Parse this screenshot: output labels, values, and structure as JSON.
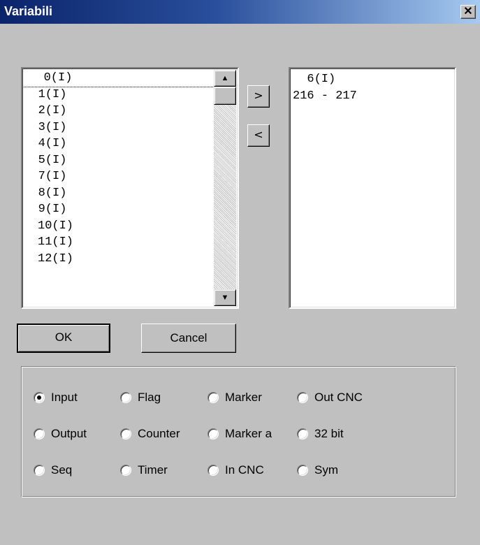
{
  "window": {
    "title": "Variabili",
    "close_glyph": "✕"
  },
  "left_list": {
    "items": [
      "0(I)",
      "1(I)",
      "2(I)",
      "3(I)",
      "4(I)",
      "5(I)",
      "7(I)",
      "8(I)",
      "9(I)",
      "10(I)",
      "11(I)",
      "12(I)"
    ],
    "focused_index": 0,
    "scroll_up_glyph": "▲",
    "scroll_down_glyph": "▼"
  },
  "move_buttons": {
    "add_label": ">",
    "remove_label": "<"
  },
  "right_list": {
    "items": [
      "  6(I)",
      "216 - 217"
    ]
  },
  "buttons": {
    "ok_label": "OK",
    "cancel_label": "Cancel"
  },
  "options": [
    {
      "label": "Input",
      "checked": true
    },
    {
      "label": "Flag",
      "checked": false
    },
    {
      "label": "Marker",
      "checked": false
    },
    {
      "label": "Out CNC",
      "checked": false
    },
    {
      "label": "Output",
      "checked": false
    },
    {
      "label": "Counter",
      "checked": false
    },
    {
      "label": "Marker a",
      "checked": false
    },
    {
      "label": "32 bit",
      "checked": false
    },
    {
      "label": "Seq",
      "checked": false
    },
    {
      "label": "Timer",
      "checked": false
    },
    {
      "label": "In CNC",
      "checked": false
    },
    {
      "label": "Sym",
      "checked": false
    }
  ],
  "colors": {
    "face": "#c0c0c0",
    "title_start": "#0a246a",
    "title_end": "#a6caf0"
  }
}
